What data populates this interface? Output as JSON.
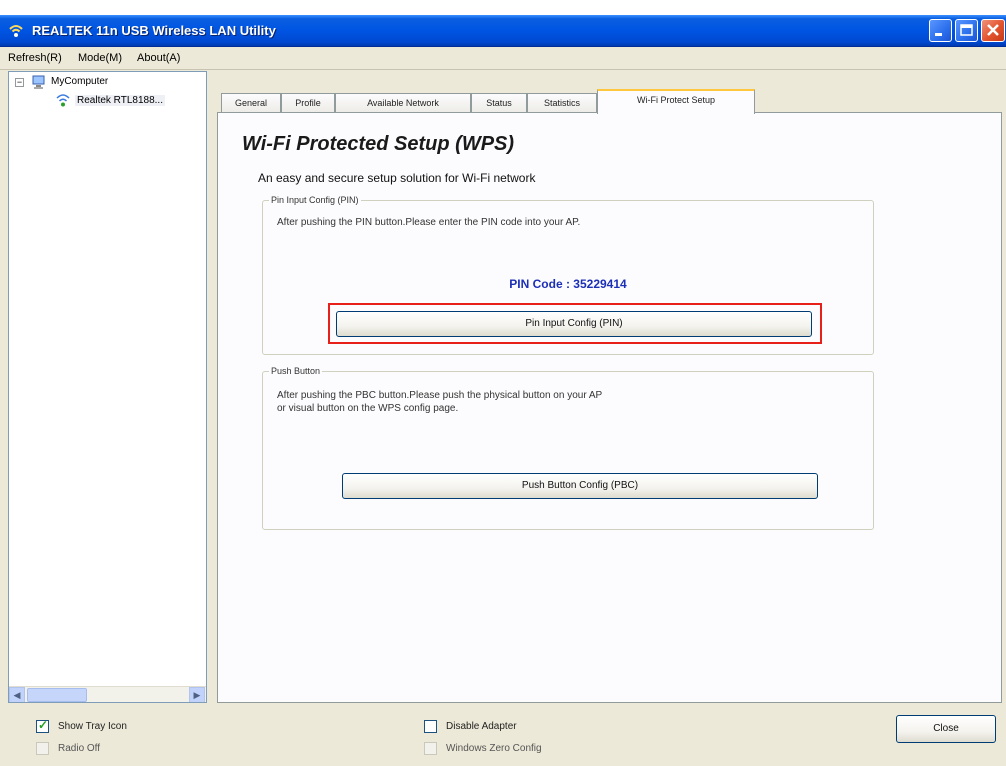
{
  "window": {
    "title": "REALTEK 11n USB Wireless LAN Utility"
  },
  "menu": [
    "Refresh(R)",
    "Mode(M)",
    "About(A)"
  ],
  "tree": {
    "root": "MyComputer",
    "child": "Realtek RTL8188..."
  },
  "tabs": [
    "General",
    "Profile",
    "Available Network",
    "Status",
    "Statistics",
    "Wi-Fi Protect Setup"
  ],
  "wps": {
    "title": "Wi-Fi Protected Setup (WPS)",
    "subtitle": "An easy and secure setup solution for Wi-Fi network",
    "pin_group": {
      "legend": "Pin Input Config (PIN)",
      "instruction": "After pushing the PIN button.Please enter the PIN code into your AP.",
      "pin_code": "PIN Code : 35229414",
      "button": "Pin Input Config (PIN)"
    },
    "pbc_group": {
      "legend": "Push Button",
      "instruction_line1": "After pushing the PBC button.Please push the physical button on your AP",
      "instruction_line2": "or visual button on the WPS config page.",
      "button": "Push Button Config (PBC)"
    }
  },
  "bottom": {
    "show_tray_icon": "Show Tray Icon",
    "radio_off": "Radio Off",
    "disable_adapter": "Disable Adapter",
    "windows_zero_config": "Windows Zero Config",
    "close_button": "Close"
  },
  "colors": {
    "titlebar": "#0054e3",
    "pin_code_text": "#1c2fb7",
    "highlight": "#e8201a"
  }
}
